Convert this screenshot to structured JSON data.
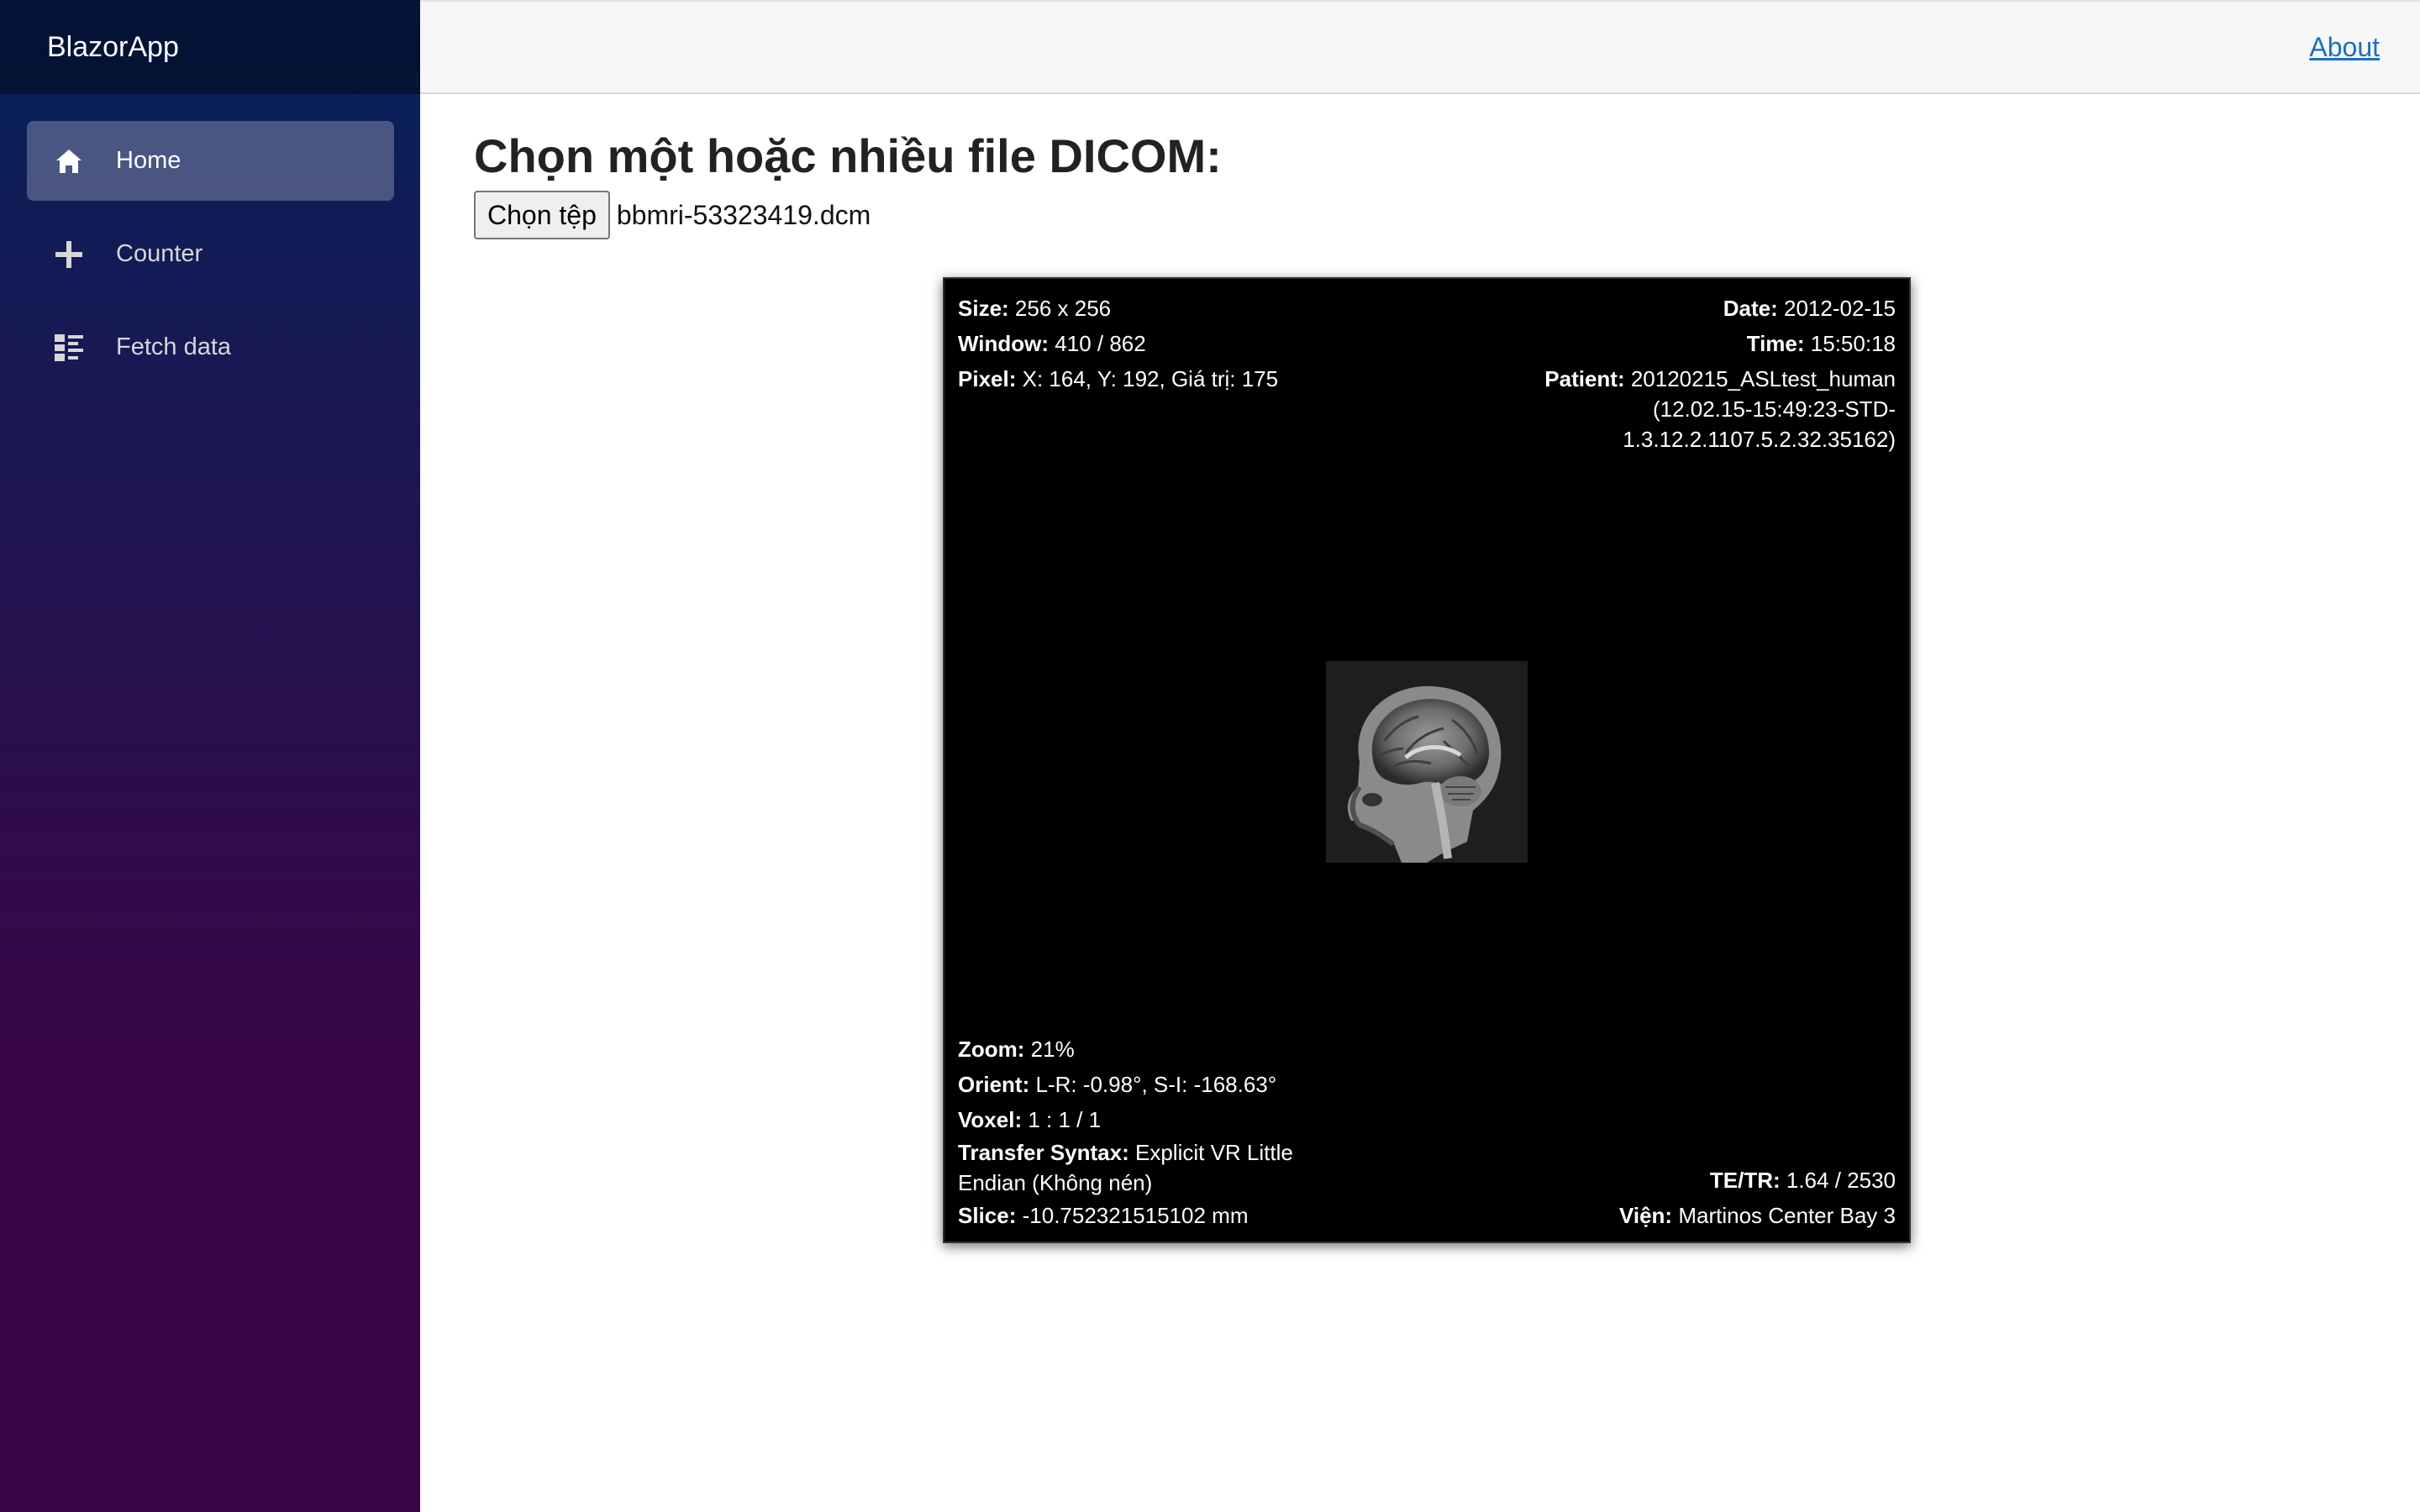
{
  "sidebar": {
    "brand": "BlazorApp",
    "items": [
      {
        "label": "Home",
        "icon": "home-icon",
        "active": true
      },
      {
        "label": "Counter",
        "icon": "plus-icon",
        "active": false
      },
      {
        "label": "Fetch data",
        "icon": "list-icon",
        "active": false
      }
    ]
  },
  "topbar": {
    "about_label": "About"
  },
  "main": {
    "title": "Chọn một hoặc nhiều file DICOM:",
    "file_button_label": "Chọn tệp",
    "file_name": "bbmri-53323419.dcm"
  },
  "viewer": {
    "size_label": "Size:",
    "size_value": "256 x 256",
    "window_label": "Window:",
    "window_value": "410 / 862",
    "pixel_label": "Pixel:",
    "pixel_value": "X: 164, Y: 192, Giá trị: 175",
    "date_label": "Date:",
    "date_value": "2012-02-15",
    "time_label": "Time:",
    "time_value": "15:50:18",
    "patient_label": "Patient:",
    "patient_value_1": "20120215_ASLtest_human",
    "patient_value_2": "(12.02.15-15:49:23-STD-",
    "patient_value_3": "1.3.12.2.1107.5.2.32.35162)",
    "zoom_label": "Zoom:",
    "zoom_value": "21%",
    "orient_label": "Orient:",
    "orient_value": "L-R: -0.98°, S-I: -168.63°",
    "voxel_label": "Voxel:",
    "voxel_value": "1 : 1 / 1",
    "transfer_label": "Transfer Syntax:",
    "transfer_value_1": "Explicit VR Little",
    "transfer_value_2": "Endian (Không nén)",
    "slice_label": "Slice:",
    "slice_value": "-10.752321515102 mm",
    "tetr_label": "TE/TR:",
    "tetr_value": "1.64 / 2530",
    "institution_label": "Viện:",
    "institution_value": "Martinos Center Bay 3"
  },
  "colors": {
    "sidebar_top": "#05225a",
    "sidebar_bottom": "#3a0647",
    "link": "#1b6ec2"
  }
}
